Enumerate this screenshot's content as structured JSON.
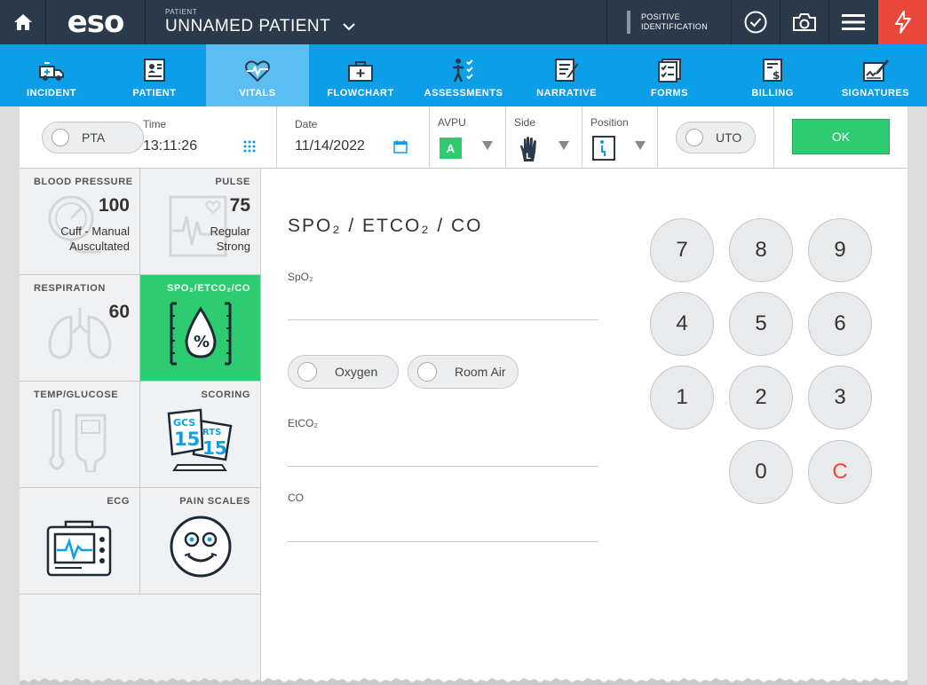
{
  "header": {
    "logo": "eso",
    "patient_label": "PATIENT",
    "patient_name": "UNNAMED PATIENT",
    "positive_id_line1": "POSITIVE",
    "positive_id_line2": "IDENTIFICATION",
    "colors": {
      "bar": "#2b3a4b",
      "alert": "#e9483b"
    }
  },
  "nav": {
    "items": [
      {
        "label": "INCIDENT",
        "icon": "ambulance-icon"
      },
      {
        "label": "PATIENT",
        "icon": "patient-card-icon"
      },
      {
        "label": "VITALS",
        "icon": "heart-pulse-icon",
        "active": true
      },
      {
        "label": "FLOWCHART",
        "icon": "medical-kit-icon"
      },
      {
        "label": "ASSESSMENTS",
        "icon": "body-checklist-icon"
      },
      {
        "label": "NARRATIVE",
        "icon": "notepad-pen-icon"
      },
      {
        "label": "FORMS",
        "icon": "forms-checklist-icon"
      },
      {
        "label": "BILLING",
        "icon": "billing-document-icon"
      },
      {
        "label": "SIGNATURES",
        "icon": "signature-pen-icon"
      }
    ],
    "color": "#0d9ee8",
    "active_color": "#5bbef2"
  },
  "top_row": {
    "pta_label": "PTA",
    "time_label": "Time",
    "time_value": "13:11:26",
    "date_label": "Date",
    "date_value": "11/14/2022",
    "avpu_label": "AVPU",
    "avpu_value": "A",
    "side_label": "Side",
    "side_value": "L",
    "position_label": "Position",
    "uto_label": "UTO",
    "ok_label": "OK"
  },
  "tiles": {
    "blood_pressure": {
      "title": "BLOOD PRESSURE",
      "value": "100",
      "line1": "Cuff - Manual",
      "line2": "Auscultated"
    },
    "pulse": {
      "title": "PULSE",
      "value": "75",
      "line1": "Regular",
      "line2": "Strong"
    },
    "respiration": {
      "title": "RESPIRATION",
      "value": "60"
    },
    "spo2": {
      "title": "SPO₂/ETCO₂/CO",
      "active": true
    },
    "temp": {
      "title": "TEMP/GLUCOSE"
    },
    "scoring": {
      "title": "SCORING",
      "gcs_label": "GCS",
      "gcs_value": "15",
      "rts_label": "RTS",
      "rts_value": "15"
    },
    "ecg": {
      "title": "ECG"
    },
    "pain": {
      "title": "PAIN SCALES"
    }
  },
  "content": {
    "title": "SPO₂ / ETCO₂ / CO",
    "spo2_label": "SpO₂",
    "spo2_value": "",
    "oxygen_label": "Oxygen",
    "room_air_label": "Room Air",
    "etco2_label": "EtCO₂",
    "etco2_value": "",
    "co_label": "CO",
    "co_value": ""
  },
  "keypad": {
    "keys": [
      "7",
      "8",
      "9",
      "4",
      "5",
      "6",
      "1",
      "2",
      "3",
      "0",
      "C"
    ]
  },
  "accent_green": "#2ecc71"
}
